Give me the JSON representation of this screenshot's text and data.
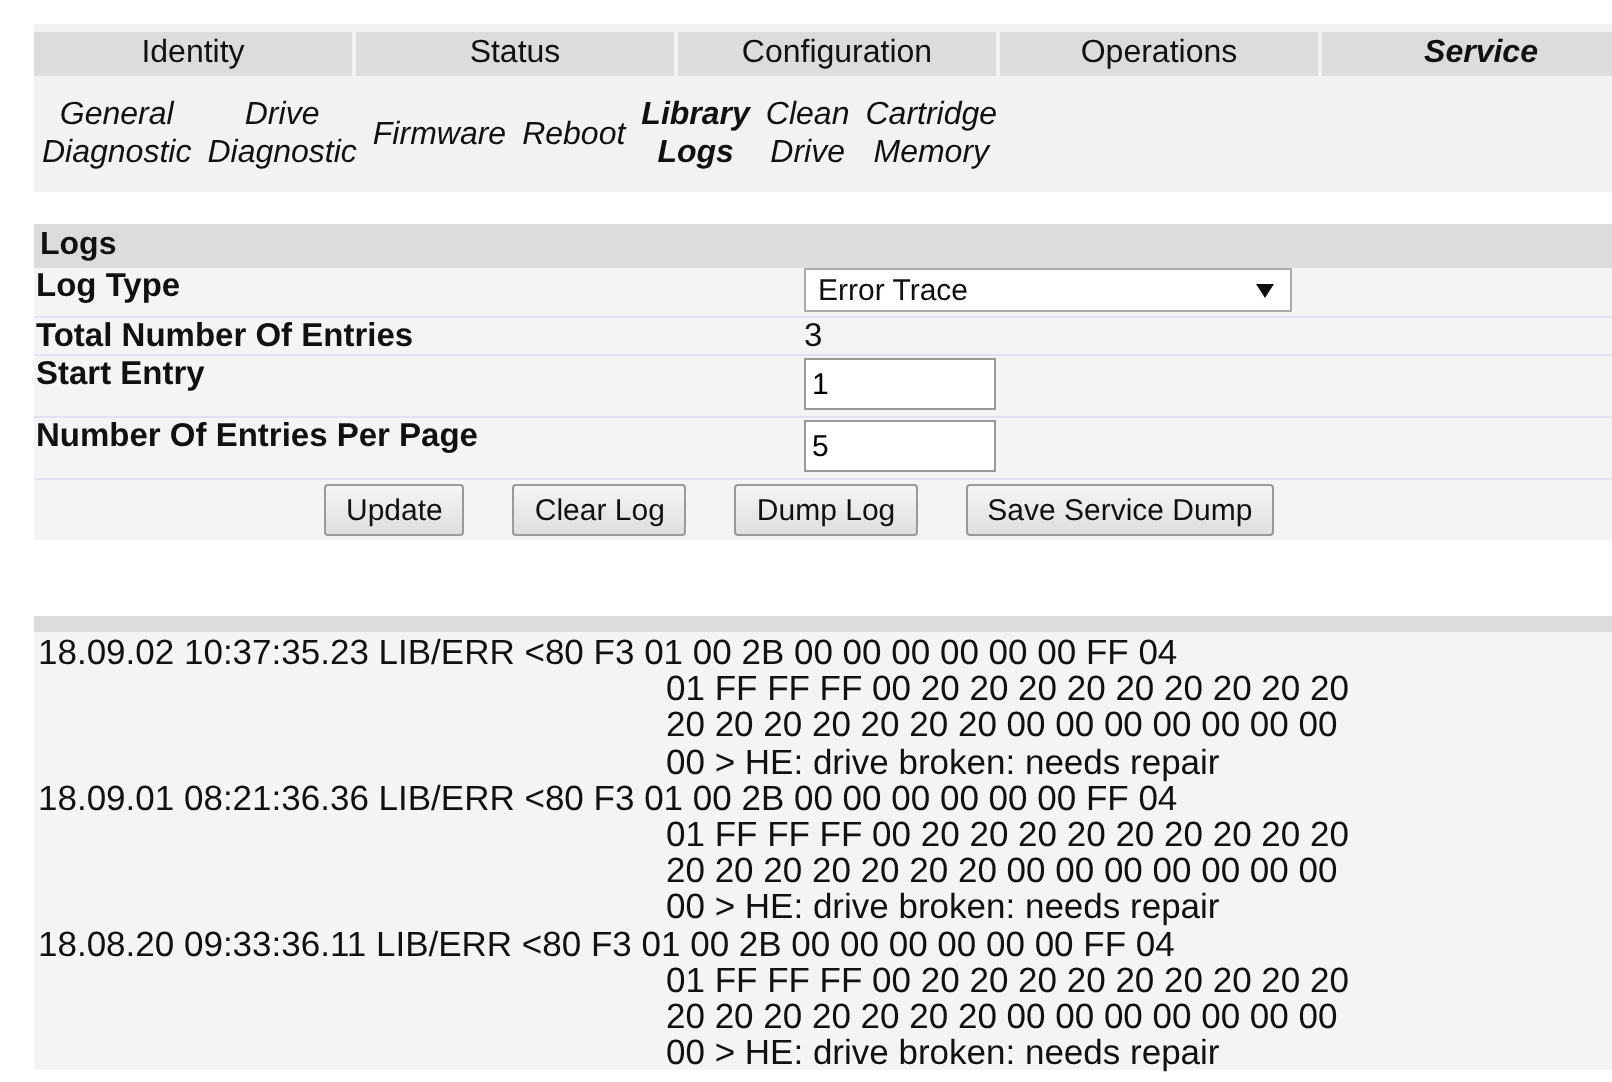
{
  "tabs": [
    {
      "label": "Identity",
      "selected": false
    },
    {
      "label": "Status",
      "selected": false
    },
    {
      "label": "Configuration",
      "selected": false
    },
    {
      "label": "Operations",
      "selected": false
    },
    {
      "label": "Service",
      "selected": true
    }
  ],
  "subtabs": [
    {
      "lines": [
        "General",
        "Diagnostic"
      ],
      "selected": false
    },
    {
      "lines": [
        "Drive",
        "Diagnostic"
      ],
      "selected": false
    },
    {
      "lines": [
        "Firmware"
      ],
      "selected": false
    },
    {
      "lines": [
        "Reboot"
      ],
      "selected": false
    },
    {
      "lines": [
        "Library",
        "Logs"
      ],
      "selected": true
    },
    {
      "lines": [
        "Clean",
        "Drive"
      ],
      "selected": false
    },
    {
      "lines": [
        "Cartridge",
        "Memory"
      ],
      "selected": false
    }
  ],
  "logs_panel": {
    "title": "Logs",
    "rows": [
      {
        "kind": "select",
        "label": "Log Type",
        "value": "Error Trace"
      },
      {
        "kind": "text",
        "label": "Total Number Of Entries",
        "value": "3"
      },
      {
        "kind": "input",
        "label": "Start Entry",
        "value": "1"
      },
      {
        "kind": "input",
        "label": "Number Of Entries Per Page",
        "value": "5"
      }
    ],
    "buttons": [
      "Update",
      "Clear Log",
      "Dump Log",
      "Save Service Dump"
    ]
  },
  "log_entries": [
    {
      "first_line": "18.09.02 10:37:35.23 LIB/ERR <80 F3 01 00 2B 00 00 00 00 00 00 FF 04",
      "lines": [
        "01 FF FF FF 00 20 20 20 20 20 20 20 20 20",
        "20 20 20 20 20 20 20 00 00 00 00 00 00 00",
        "00 > HE: drive broken: needs repair"
      ]
    },
    {
      "first_line": "18.09.01 08:21:36.36 LIB/ERR <80 F3 01 00 2B 00 00 00 00 00 00 FF 04",
      "lines": [
        "01 FF FF FF 00 20 20 20 20 20 20 20 20 20",
        "20 20 20 20 20 20 20 00 00 00 00 00 00 00",
        "00 > HE: drive broken: needs repair"
      ]
    },
    {
      "first_line": "18.08.20 09:33:36.11 LIB/ERR <80 F3 01 00 2B 00 00 00 00 00 00 FF 04",
      "lines": [
        "01 FF FF FF 00 20 20 20 20 20 20 20 20 20",
        "20 20 20 20 20 20 20 00 00 00 00 00 00 00",
        "00 > HE: drive broken: needs repair"
      ]
    }
  ]
}
